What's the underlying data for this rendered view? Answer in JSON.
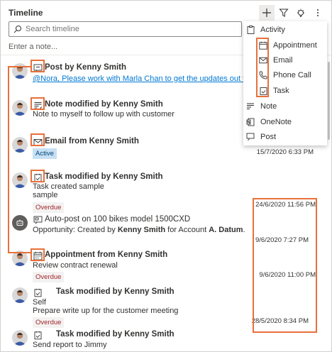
{
  "header": {
    "title": "Timeline"
  },
  "search": {
    "placeholder": "Search timeline"
  },
  "note": {
    "placeholder": "Enter a note..."
  },
  "menu": {
    "items": [
      {
        "label": "Activity",
        "icon": "clipboard-icon"
      },
      {
        "label": "Appointment",
        "icon": "calendar-icon"
      },
      {
        "label": "Email",
        "icon": "mail-icon"
      },
      {
        "label": "Phone Call",
        "icon": "phone-icon"
      },
      {
        "label": "Task",
        "icon": "task-icon"
      },
      {
        "label": "Note",
        "icon": "note-icon"
      },
      {
        "label": "OneNote",
        "icon": "onenote-icon"
      },
      {
        "label": "Post",
        "icon": "post-icon"
      }
    ]
  },
  "entries": [
    {
      "title": "Post by Kenny Smith",
      "link": "@Nora, Please work with Marla Chan to get the updates out today."
    },
    {
      "title": "Note modified by Kenny Smith",
      "lines": [
        "Note to myself to follow up with customer"
      ]
    },
    {
      "title": "Email from Kenny Smith",
      "badge": "Active",
      "timestamp": "15/7/2020 6:33 PM"
    },
    {
      "title": "Task modified by Kenny Smith",
      "lines": [
        "Task created sample",
        "sample"
      ],
      "badge": "Overdue",
      "timestamp": "24/6/2020 11:56 PM"
    },
    {
      "title": "Auto-post on 100 bikes model 1500CXD",
      "line_prefix": "Opportunity: Created by ",
      "line_bold1": "Kenny Smith",
      "line_mid": " for Account ",
      "line_bold2": "A. Datum",
      "line_suffix": ".",
      "timestamp": "9/6/2020 7:27 PM"
    },
    {
      "title": "Appointment from Kenny Smith",
      "lines": [
        "Review contract renewal"
      ],
      "badge": "Overdue",
      "timestamp": "9/6/2020 11:00 PM"
    },
    {
      "title": "Task modified by Kenny Smith",
      "lines": [
        "Self",
        "Prepare write up for the customer meeting"
      ],
      "badge": "Overdue",
      "timestamp": "28/5/2020 8:34 PM"
    },
    {
      "title": "Task modified by Kenny Smith",
      "lines": [
        "Send report to Jimmy"
      ]
    }
  ]
}
